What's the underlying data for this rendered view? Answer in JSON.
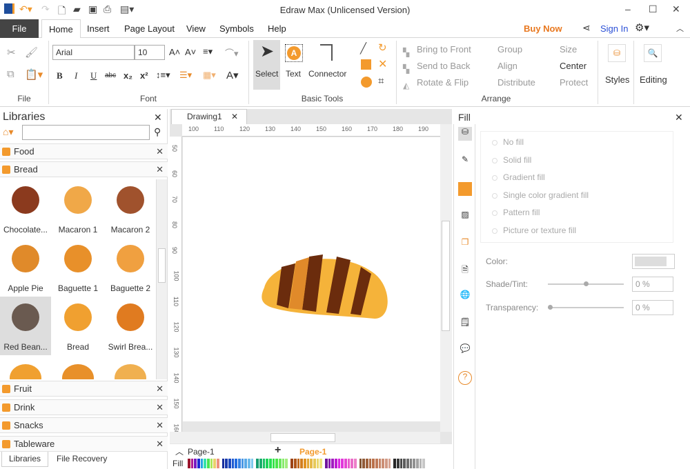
{
  "app": {
    "title": "Edraw Max (Unlicensed Version)"
  },
  "menu": {
    "file": "File",
    "tabs": [
      "Home",
      "Insert",
      "Page Layout",
      "View",
      "Symbols",
      "Help"
    ],
    "buy_now": "Buy Now",
    "sign_in": "Sign In"
  },
  "ribbon": {
    "file_group": "File",
    "font_group": "Font",
    "font_name": "Arial",
    "font_size": "10",
    "font_buttons": [
      "B",
      "I",
      "U",
      "abc",
      "x₂",
      "x²"
    ],
    "basic_tools_group": "Basic Tools",
    "select": "Select",
    "text": "Text",
    "connector": "Connector",
    "arrange_group": "Arrange",
    "arrange": [
      "Bring to Front",
      "Send to Back",
      "Rotate & Flip",
      "Group",
      "Align",
      "Distribute",
      "Size",
      "Center",
      "Protect"
    ],
    "styles": "Styles",
    "editing": "Editing"
  },
  "libraries": {
    "title": "Libraries",
    "search_placeholder": "",
    "categories_top": [
      "Food",
      "Bread"
    ],
    "items": [
      {
        "label": "Chocolate...",
        "color": "#8b3a1e"
      },
      {
        "label": "Macaron 1",
        "color": "#f0a848"
      },
      {
        "label": "Macaron 2",
        "color": "#a0522d"
      },
      {
        "label": "Apple Pie",
        "color": "#e08a2a"
      },
      {
        "label": "Baguette 1",
        "color": "#e8902a"
      },
      {
        "label": "Baguette 2",
        "color": "#f0a040"
      },
      {
        "label": "Red Bean...",
        "color": "#6a5a50"
      },
      {
        "label": "Bread",
        "color": "#f0a030"
      },
      {
        "label": "Swirl Brea...",
        "color": "#e07b20"
      }
    ],
    "categories_bottom": [
      "Fruit",
      "Drink",
      "Snacks",
      "Tableware"
    ],
    "bottom_tabs": [
      "Libraries",
      "File Recovery"
    ]
  },
  "document": {
    "tab": "Drawing1",
    "ruler_h": [
      "100",
      "110",
      "120",
      "130",
      "140",
      "150",
      "160",
      "170",
      "180",
      "190"
    ],
    "ruler_v": [
      "50",
      "60",
      "70",
      "80",
      "90",
      "100",
      "110",
      "120",
      "130",
      "140",
      "150",
      "160"
    ],
    "page_select": "Page-1",
    "active_page": "Page-1",
    "fill_label": "Fill"
  },
  "fill_panel": {
    "title": "Fill",
    "options": [
      "No fill",
      "Solid fill",
      "Gradient fill",
      "Single color gradient fill",
      "Pattern fill",
      "Picture or texture fill"
    ],
    "selected": "Solid fill",
    "color_label": "Color:",
    "shade_label": "Shade/Tint:",
    "shade_value": "0 %",
    "transparency_label": "Transparency:",
    "transparency_value": "0 %"
  },
  "colors": {
    "accent": "#f39a2d",
    "sign_in": "#2a4fd6",
    "buy_now": "#e8771e"
  }
}
